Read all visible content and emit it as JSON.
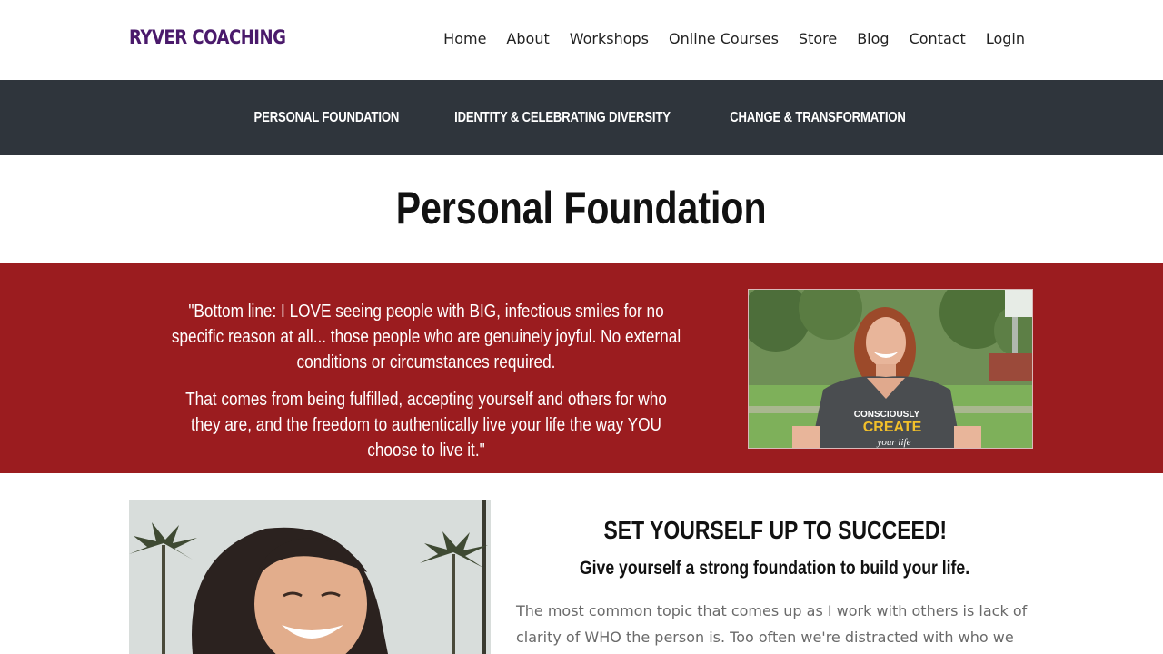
{
  "header": {
    "logo": "RYVER COACHING",
    "nav": [
      "Home",
      "About",
      "Workshops",
      "Online Courses",
      "Store",
      "Blog",
      "Contact",
      "Login"
    ]
  },
  "subnav": [
    "PERSONAL FOUNDATION",
    "IDENTITY & CELEBRATING DIVERSITY",
    "CHANGE & TRANSFORMATION"
  ],
  "page": {
    "title": "Personal Foundation"
  },
  "quote": {
    "paragraph1": "\"Bottom line: I LOVE seeing people with BIG, infectious smiles for no specific reason at all... those people who are genuinely joyful. No external conditions or circumstances required.",
    "paragraph2": "That comes from being fulfilled, accepting yourself and others for who they are, and the freedom to authentically live your life the way YOU choose to live it.\"",
    "shirt_text": [
      "CONSCIOUSLY",
      "CREATE",
      "your life"
    ]
  },
  "section": {
    "heading": "SET YOURSELF UP TO SUCCEED!",
    "subheading": "Give yourself a strong foundation to build your life.",
    "body": "The most common topic that comes up as I work with others is lack of clarity of WHO the person is. Too often we're distracted with who we believe we're"
  },
  "colors": {
    "logo": "#4a1a6b",
    "subnav_bg": "#2f353c",
    "quote_bg": "#9b1c1f"
  }
}
